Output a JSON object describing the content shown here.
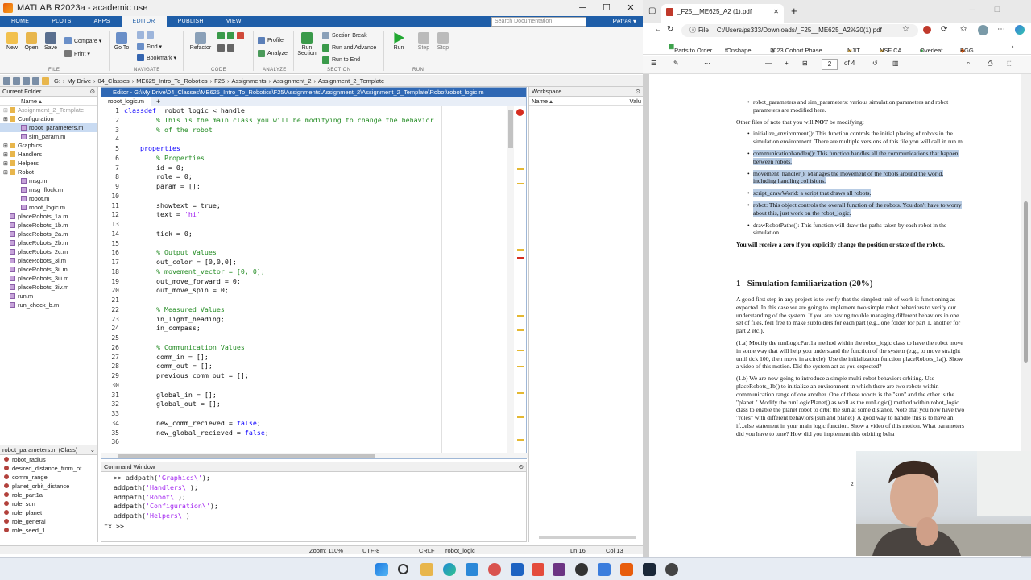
{
  "matlab": {
    "title": "MATLAB R2023a - academic use",
    "window_controls": [
      "─",
      "☐",
      "✕"
    ],
    "tabs": [
      "HOME",
      "PLOTS",
      "APPS",
      "EDITOR",
      "PUBLISH",
      "VIEW"
    ],
    "search_placeholder": "Search Documentation",
    "user": "Petras ▾",
    "ribbon": {
      "new": "New",
      "open": "Open",
      "save": "Save",
      "compare": "Compare ▾",
      "print": "Print ▾",
      "goto": "Go To",
      "find": "Find ▾",
      "bookmark": "Bookmark ▾",
      "refactor": "Refactor",
      "profiler": "Profiler",
      "analyze": "Analyze",
      "run_section": "Run Section",
      "section_break": "Section Break",
      "run_advance": "Run and Advance",
      "run_end": "Run to End",
      "run": "Run",
      "step": "Step",
      "stop": "Stop",
      "groups": [
        "FILE",
        "NAVIGATE",
        "CODE",
        "ANALYZE",
        "SECTION",
        "RUN"
      ]
    },
    "path": [
      "G:",
      "My Drive",
      "04_Classes",
      "ME625_Intro_To_Robotics",
      "F25",
      "Assignments",
      "Assignment_2",
      "Assignment_2_Template"
    ],
    "current_folder": {
      "title": "Current Folder",
      "column": "Name ▴",
      "items": [
        {
          "name": "Assignment_2_Template",
          "type": "folder",
          "indent": 0,
          "dim": true
        },
        {
          "name": "Configuration",
          "type": "folder",
          "indent": 0
        },
        {
          "name": "robot_parameters.m",
          "type": "m",
          "indent": 1,
          "selected": true
        },
        {
          "name": "sim_param.m",
          "type": "m",
          "indent": 1
        },
        {
          "name": "Graphics",
          "type": "folder",
          "indent": 0
        },
        {
          "name": "Handlers",
          "type": "folder",
          "indent": 0
        },
        {
          "name": "Helpers",
          "type": "folder",
          "indent": 0
        },
        {
          "name": "Robot",
          "type": "folder",
          "indent": 0
        },
        {
          "name": "msg.m",
          "type": "m",
          "indent": 1
        },
        {
          "name": "msg_flock.m",
          "type": "m",
          "indent": 1
        },
        {
          "name": "robot.m",
          "type": "m",
          "indent": 1
        },
        {
          "name": "robot_logic.m",
          "type": "m",
          "indent": 1
        },
        {
          "name": "placeRobots_1a.m",
          "type": "m",
          "indent": 0
        },
        {
          "name": "placeRobots_1b.m",
          "type": "m",
          "indent": 0
        },
        {
          "name": "placeRobots_2a.m",
          "type": "m",
          "indent": 0
        },
        {
          "name": "placeRobots_2b.m",
          "type": "m",
          "indent": 0
        },
        {
          "name": "placeRobots_2c.m",
          "type": "m",
          "indent": 0
        },
        {
          "name": "placeRobots_3i.m",
          "type": "m",
          "indent": 0
        },
        {
          "name": "placeRobots_3ii.m",
          "type": "m",
          "indent": 0
        },
        {
          "name": "placeRobots_3iii.m",
          "type": "m",
          "indent": 0
        },
        {
          "name": "placeRobots_3iv.m",
          "type": "m",
          "indent": 0
        },
        {
          "name": "run.m",
          "type": "m",
          "indent": 0
        },
        {
          "name": "run_check_b.m",
          "type": "m",
          "indent": 0
        }
      ]
    },
    "details": {
      "title": "robot_parameters.m  (Class)",
      "items": [
        "robot_radius",
        "desired_distance_from_ot...",
        "comm_range",
        "planet_orbit_distance",
        "role_part1a",
        "role_sun",
        "role_planet",
        "role_general",
        "role_seed_1"
      ]
    },
    "editor": {
      "header": "Editor - G:\\My Drive\\04_Classes\\ME625_Intro_To_Robotics\\F25\\Assignments\\Assignment_2\\Assignment_2_Template\\Robot\\robot_logic.m",
      "tab": "robot_logic.m",
      "plus": "+",
      "lines": [
        [
          [
            "kw",
            "classdef"
          ],
          [
            "",
            "  robot_logic < handle"
          ]
        ],
        [
          [
            "cm",
            "        % This is the main class you will be modifying to change the behavior"
          ]
        ],
        [
          [
            "cm",
            "        % of the robot"
          ]
        ],
        [
          [
            "",
            ""
          ]
        ],
        [
          [
            "kw",
            "    properties"
          ]
        ],
        [
          [
            "cm",
            "        % Properties"
          ]
        ],
        [
          [
            "",
            "        id = 0;"
          ]
        ],
        [
          [
            "",
            "        role = 0;"
          ]
        ],
        [
          [
            "",
            "        param = [];"
          ]
        ],
        [
          [
            "",
            ""
          ]
        ],
        [
          [
            "",
            "        showtext = true;"
          ]
        ],
        [
          [
            "",
            "        text = "
          ],
          [
            "st",
            "'hi'"
          ]
        ],
        [
          [
            "",
            ""
          ]
        ],
        [
          [
            "",
            "        tick = 0;"
          ]
        ],
        [
          [
            "",
            ""
          ]
        ],
        [
          [
            "cm",
            "        % Output Values"
          ]
        ],
        [
          [
            "",
            "        out_color = [0,0,0];"
          ]
        ],
        [
          [
            "cm",
            "        % movement_vector = [0, 0];"
          ]
        ],
        [
          [
            "",
            "        out_move_forward = 0;"
          ]
        ],
        [
          [
            "",
            "        out_move_spin = 0;"
          ]
        ],
        [
          [
            "",
            ""
          ]
        ],
        [
          [
            "cm",
            "        % Measured Values"
          ]
        ],
        [
          [
            "",
            "        in_light_heading;"
          ]
        ],
        [
          [
            "",
            "        in_compass;"
          ]
        ],
        [
          [
            "",
            ""
          ]
        ],
        [
          [
            "cm",
            "        % Communication Values"
          ]
        ],
        [
          [
            "",
            "        comm_in = [];"
          ]
        ],
        [
          [
            "",
            "        comm_out = [];"
          ]
        ],
        [
          [
            "",
            "        previous_comm_out = [];"
          ]
        ],
        [
          [
            "",
            ""
          ]
        ],
        [
          [
            "",
            "        global_in = [];"
          ]
        ],
        [
          [
            "",
            "        global_out = [];"
          ]
        ],
        [
          [
            "",
            ""
          ]
        ],
        [
          [
            "",
            "        new_comm_recieved = "
          ],
          [
            "kw",
            "false"
          ],
          [
            "",
            ";"
          ]
        ],
        [
          [
            "",
            "        new_global_recieved = "
          ],
          [
            "kw",
            "false"
          ],
          [
            "",
            ";"
          ]
        ],
        [
          [
            "",
            ""
          ]
        ]
      ]
    },
    "command_window": {
      "title": "Command Window",
      "lines": [
        [
          [
            ">> addpath("
          ],
          [
            "'Graphics\\'"
          ],
          [
            ");"
          ]
        ],
        [
          [
            "addpath("
          ],
          [
            "'Handlers\\'"
          ],
          [
            ");"
          ]
        ],
        [
          [
            "addpath("
          ],
          [
            "'Robot\\'"
          ],
          [
            ");"
          ]
        ],
        [
          [
            "addpath("
          ],
          [
            "'Configuration\\'"
          ],
          [
            ");"
          ]
        ],
        [
          [
            "addpath("
          ],
          [
            "'Helpers\\'"
          ],
          [
            ")"
          ]
        ]
      ],
      "prompt": "fx >>"
    },
    "workspace": {
      "title": "Workspace",
      "column": "Name ▴",
      "value_column": "Valu"
    },
    "status": {
      "zoom": "Zoom: 110%",
      "encoding": "UTF-8",
      "eol": "CRLF",
      "file": "robot_logic",
      "ln": "Ln  16",
      "col": "Col  13"
    }
  },
  "browser": {
    "tab_title": "_F25__ME625_A2 (1).pdf",
    "tab_close": "✕",
    "new_tab": "+",
    "url_prefix": "File",
    "url": "C:/Users/ps333/Downloads/_F25__ME625_A2%20(1).pdf",
    "bookmarks": [
      "Parts to Order",
      "fOnshape",
      "2023 Cohort Phase...",
      "NJIT",
      "NSF CA",
      "Overleaf",
      "BGG"
    ],
    "pdf_toolbar": {
      "minus": "—",
      "plus": "+",
      "page": "2",
      "of": "of 4"
    },
    "pdf": {
      "bullet_top": "robot_parameters and sim_parameters: various simulation parameters and robot parameters are modified here.",
      "other_files_pre": "Other files of note that you will ",
      "other_files_not": "NOT",
      "other_files_post": " be modifying:",
      "list": [
        {
          "text": "initialize_environment(): This function controls the initial placing of robots in the simulation environment. There are multiple versions of this file you will call in run.m.",
          "hl": false
        },
        {
          "text": "communicationhandler(): This function handles all the communications that happen between robots.",
          "hl": true
        },
        {
          "text": "movement_handler(): Manages the movement of the robots around the world, including handling collisions.",
          "hl": true
        },
        {
          "text": "script_drawWorld: a script that draws all robots.",
          "hl": true
        },
        {
          "text": "robot: This object controls the overall function of the robots. You don't have to worry about this, just work on the robot_logic.",
          "hl": true
        },
        {
          "text": "drawRobotPaths(): This function will draw the paths taken by each robot in the simulation.",
          "hl": false
        }
      ],
      "zero_warning": "You will receive a zero if you explicitly change the position or state of the robots.",
      "section_num": "1",
      "section_title": "Simulation familiarization (20%)",
      "para1": "A good first step in any project is to verify that the simplest unit of work is functioning as expected. In this case we are going to implement two simple robot behaviors to verify our understanding of the system. If you are having trouble managing different behaviors in one set of files, feel free to make subfolders for each part (e.g., one folder for part 1, another for part 2 etc.).",
      "para2": "(1.a) Modify the runLogicPart1a method within the robot_logic class to have the robot move in some way that will help you understand the function of the system (e.g., to move straight until tick 100, then move in a circle). Use the initialization function placeRobots_1a(). Show a video of this motion. Did the system act as you expected?",
      "para3": "(1.b) We are now going to introduce a simple multi-robot behavior: orbiting. Use placeRobots_1b() to initialize an environment in which there are two robots within communication range of one another. One of these robots is the \"sun\" and the other is the \"planet.\" Modify the runLogicPlanet() as well as the runLogic() method within robot_logic class to enable the planet robot to orbit the sun at some distance. Note that you now have two \"roles\" with different behaviors (sun and planet). A good way to handle this is to have an if...else statement in your main logic function. Show a video of this motion. What parameters did you have to tune? How did you implement this orbiting beha",
      "page_num": "2"
    }
  }
}
